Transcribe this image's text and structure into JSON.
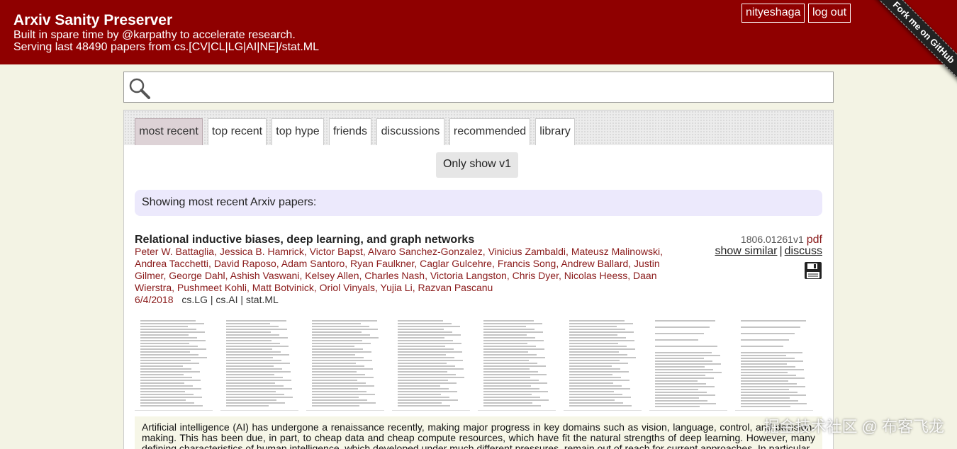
{
  "header": {
    "title": "Arxiv Sanity Preserver",
    "subtitle_1": "Built in spare time by @karpathy to accelerate research.",
    "subtitle_2": "Serving last 48490 papers from cs.[CV|CL|LG|AI|NE]/stat.ML",
    "username": "nityeshaga",
    "logout_label": "log out",
    "ribbon_text": "Fork me on GitHub",
    "bg_color": "#8f0000"
  },
  "search": {
    "value": "",
    "placeholder": ""
  },
  "tabs": [
    {
      "label": "most recent",
      "active": true
    },
    {
      "label": "top recent",
      "active": false
    },
    {
      "label": "top hype",
      "active": false
    },
    {
      "label": "friends",
      "active": false
    },
    {
      "label": "discussions",
      "active": false
    },
    {
      "label": "recommended",
      "active": false
    },
    {
      "label": "library",
      "active": false
    }
  ],
  "v1_button": "Only show v1",
  "showing_text": "Showing most recent Arxiv papers:",
  "paper": {
    "title": "Relational inductive biases, deep learning, and graph networks",
    "authors": [
      "Peter W. Battaglia",
      "Jessica B. Hamrick",
      "Victor Bapst",
      "Alvaro Sanchez-Gonzalez",
      "Vinicius Zambaldi",
      "Mateusz Malinowski",
      "Andrea Tacchetti",
      "David Raposo",
      "Adam Santoro",
      "Ryan Faulkner",
      "Caglar Gulcehre",
      "Francis Song",
      "Andrew Ballard",
      "Justin Gilmer",
      "George Dahl",
      "Ashish Vaswani",
      "Kelsey Allen",
      "Charles Nash",
      "Victoria Langston",
      "Chris Dyer",
      "Nicolas Heess",
      "Daan Wierstra",
      "Pushmeet Kohli",
      "Matt Botvinick",
      "Oriol Vinyals",
      "Yujia Li",
      "Razvan Pascanu"
    ],
    "date": "6/4/2018",
    "categories": "cs.LG | cs.AI | stat.ML",
    "arxiv_id": "1806.01261v1",
    "pdf_label": "pdf",
    "show_similar_label": "show similar",
    "discuss_label": "discuss",
    "save_icon": "save-icon",
    "abstract": "Artificial intelligence (AI) has undergone a renaissance recently, making major progress in key domains such as vision, language, control, and decision-making. This has been due, in part, to cheap data and cheap compute resources, which have fit the natural strengths of deep learning. However, many defining characteristics of human intelligence, which developed under much different pressures, remain out of reach for current approaches. In particular"
  },
  "watermark": "掘金技术社区 @ 布客飞龙"
}
